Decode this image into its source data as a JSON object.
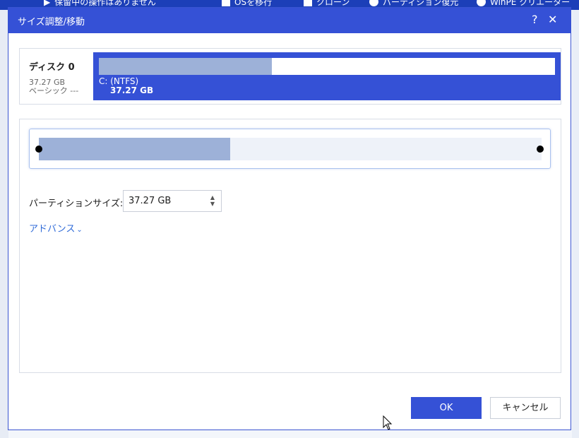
{
  "background": {
    "toolbar_items": [
      {
        "label": "保留中の操作はありません",
        "icon": "play-icon"
      },
      {
        "label": "OSを移行",
        "icon": "windows-icon"
      },
      {
        "label": "クローン",
        "icon": "clone-icon"
      },
      {
        "label": "パーティション復元",
        "icon": "pie-icon"
      },
      {
        "label": "WinPE クリエーター",
        "icon": "winpe-icon"
      }
    ]
  },
  "dialog": {
    "title": "サイズ調整/移動",
    "help_label": "?",
    "close_label": "✕"
  },
  "disk": {
    "name": "ディスク 0",
    "size": "37.27 GB",
    "type": "ベーシック ---",
    "partition": {
      "label": "C: (NTFS)",
      "size": "37.27 GB",
      "used_fraction": 0.38
    }
  },
  "resize": {
    "used_fraction": 0.38,
    "partition_size_label": "パーティションサイズ:",
    "partition_size_value": "37.27 GB",
    "advanced_label": "アドバンス"
  },
  "buttons": {
    "ok": "OK",
    "cancel": "キャンセル"
  },
  "colors": {
    "accent": "#3551d6",
    "used_fill": "#9db1d8",
    "link": "#2f6ad8"
  }
}
